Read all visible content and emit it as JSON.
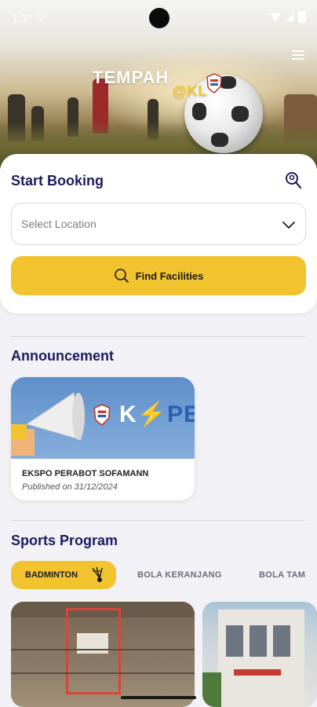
{
  "status_bar": {
    "time": "1:37"
  },
  "hero": {
    "logo_main": "TEMPAH",
    "logo_sub": "@KL"
  },
  "booking": {
    "title": "Start Booking",
    "select_placeholder": "Select Location",
    "find_label": "Find Facilities"
  },
  "announcement": {
    "title": "Announcement",
    "card": {
      "brand_first": "K",
      "brand_rest": "PE",
      "name": "EKSPO PERABOT SOFAMANN",
      "date": "Published on 31/12/2024"
    }
  },
  "sports": {
    "title": "Sports Program",
    "chips": [
      {
        "label": "BADMINTON",
        "active": true
      },
      {
        "label": "BOLA KERANJANG",
        "active": false
      },
      {
        "label": "BOLA TAM",
        "active": false
      }
    ]
  },
  "colors": {
    "accent": "#f1c42f",
    "heading": "#1c1c5e",
    "background": "#f1f1f6"
  }
}
